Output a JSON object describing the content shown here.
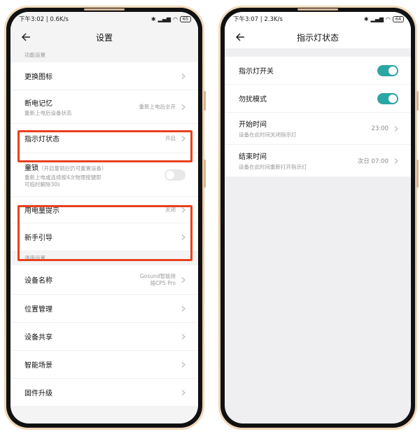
{
  "left": {
    "status": {
      "time": "下午3:02",
      "speed": "0.6K/s",
      "battery": "65"
    },
    "title": "设置",
    "section1": "功能设置",
    "items": [
      {
        "label": "更换图标",
        "sub": "",
        "value": ""
      },
      {
        "label": "断电记忆",
        "sub": "重新上电后设备状态",
        "value": "重新上电后全开"
      },
      {
        "label": "指示灯状态",
        "sub": "",
        "value": "开启"
      },
      {
        "label": "童锁",
        "label_note": "（开启童锁后仍可重置设备）",
        "sub_line1": "重新上电或连续按4次物理按键即",
        "sub_line2": "可临时解除30s",
        "toggle": false
      },
      {
        "label": "用电量提示",
        "sub": "",
        "value": "关闭"
      },
      {
        "label": "新手引导",
        "sub": "",
        "value": ""
      }
    ],
    "section2": "通用设置",
    "items2": [
      {
        "label": "设备名称",
        "value_line1": "Gosund智能排",
        "value_line2": "插CP5 Pro"
      },
      {
        "label": "位置管理"
      },
      {
        "label": "设备共享"
      },
      {
        "label": "智能场景"
      },
      {
        "label": "固件升级"
      }
    ]
  },
  "right": {
    "status": {
      "time": "下午3:07",
      "speed": "2.3K/s",
      "battery": "64"
    },
    "title": "指示灯状态",
    "items": [
      {
        "label": "指示灯开关",
        "toggle": true
      },
      {
        "label": "勿扰模式",
        "toggle": true
      },
      {
        "label": "开始时间",
        "sub": "设备在此时间关闭指示灯",
        "value": "23:00"
      },
      {
        "label": "结束时间",
        "sub": "设备在此时间重新打开指示灯",
        "value": "次日 07:00"
      }
    ]
  },
  "colors": {
    "toggle_on": "#2aa6a4",
    "highlight": "#e8401f",
    "frame": "#e9c9a4"
  },
  "icons": [
    "back-arrow-icon",
    "chevron-right-icon",
    "bluetooth-icon",
    "signal-icon",
    "wifi-icon",
    "battery-icon"
  ]
}
